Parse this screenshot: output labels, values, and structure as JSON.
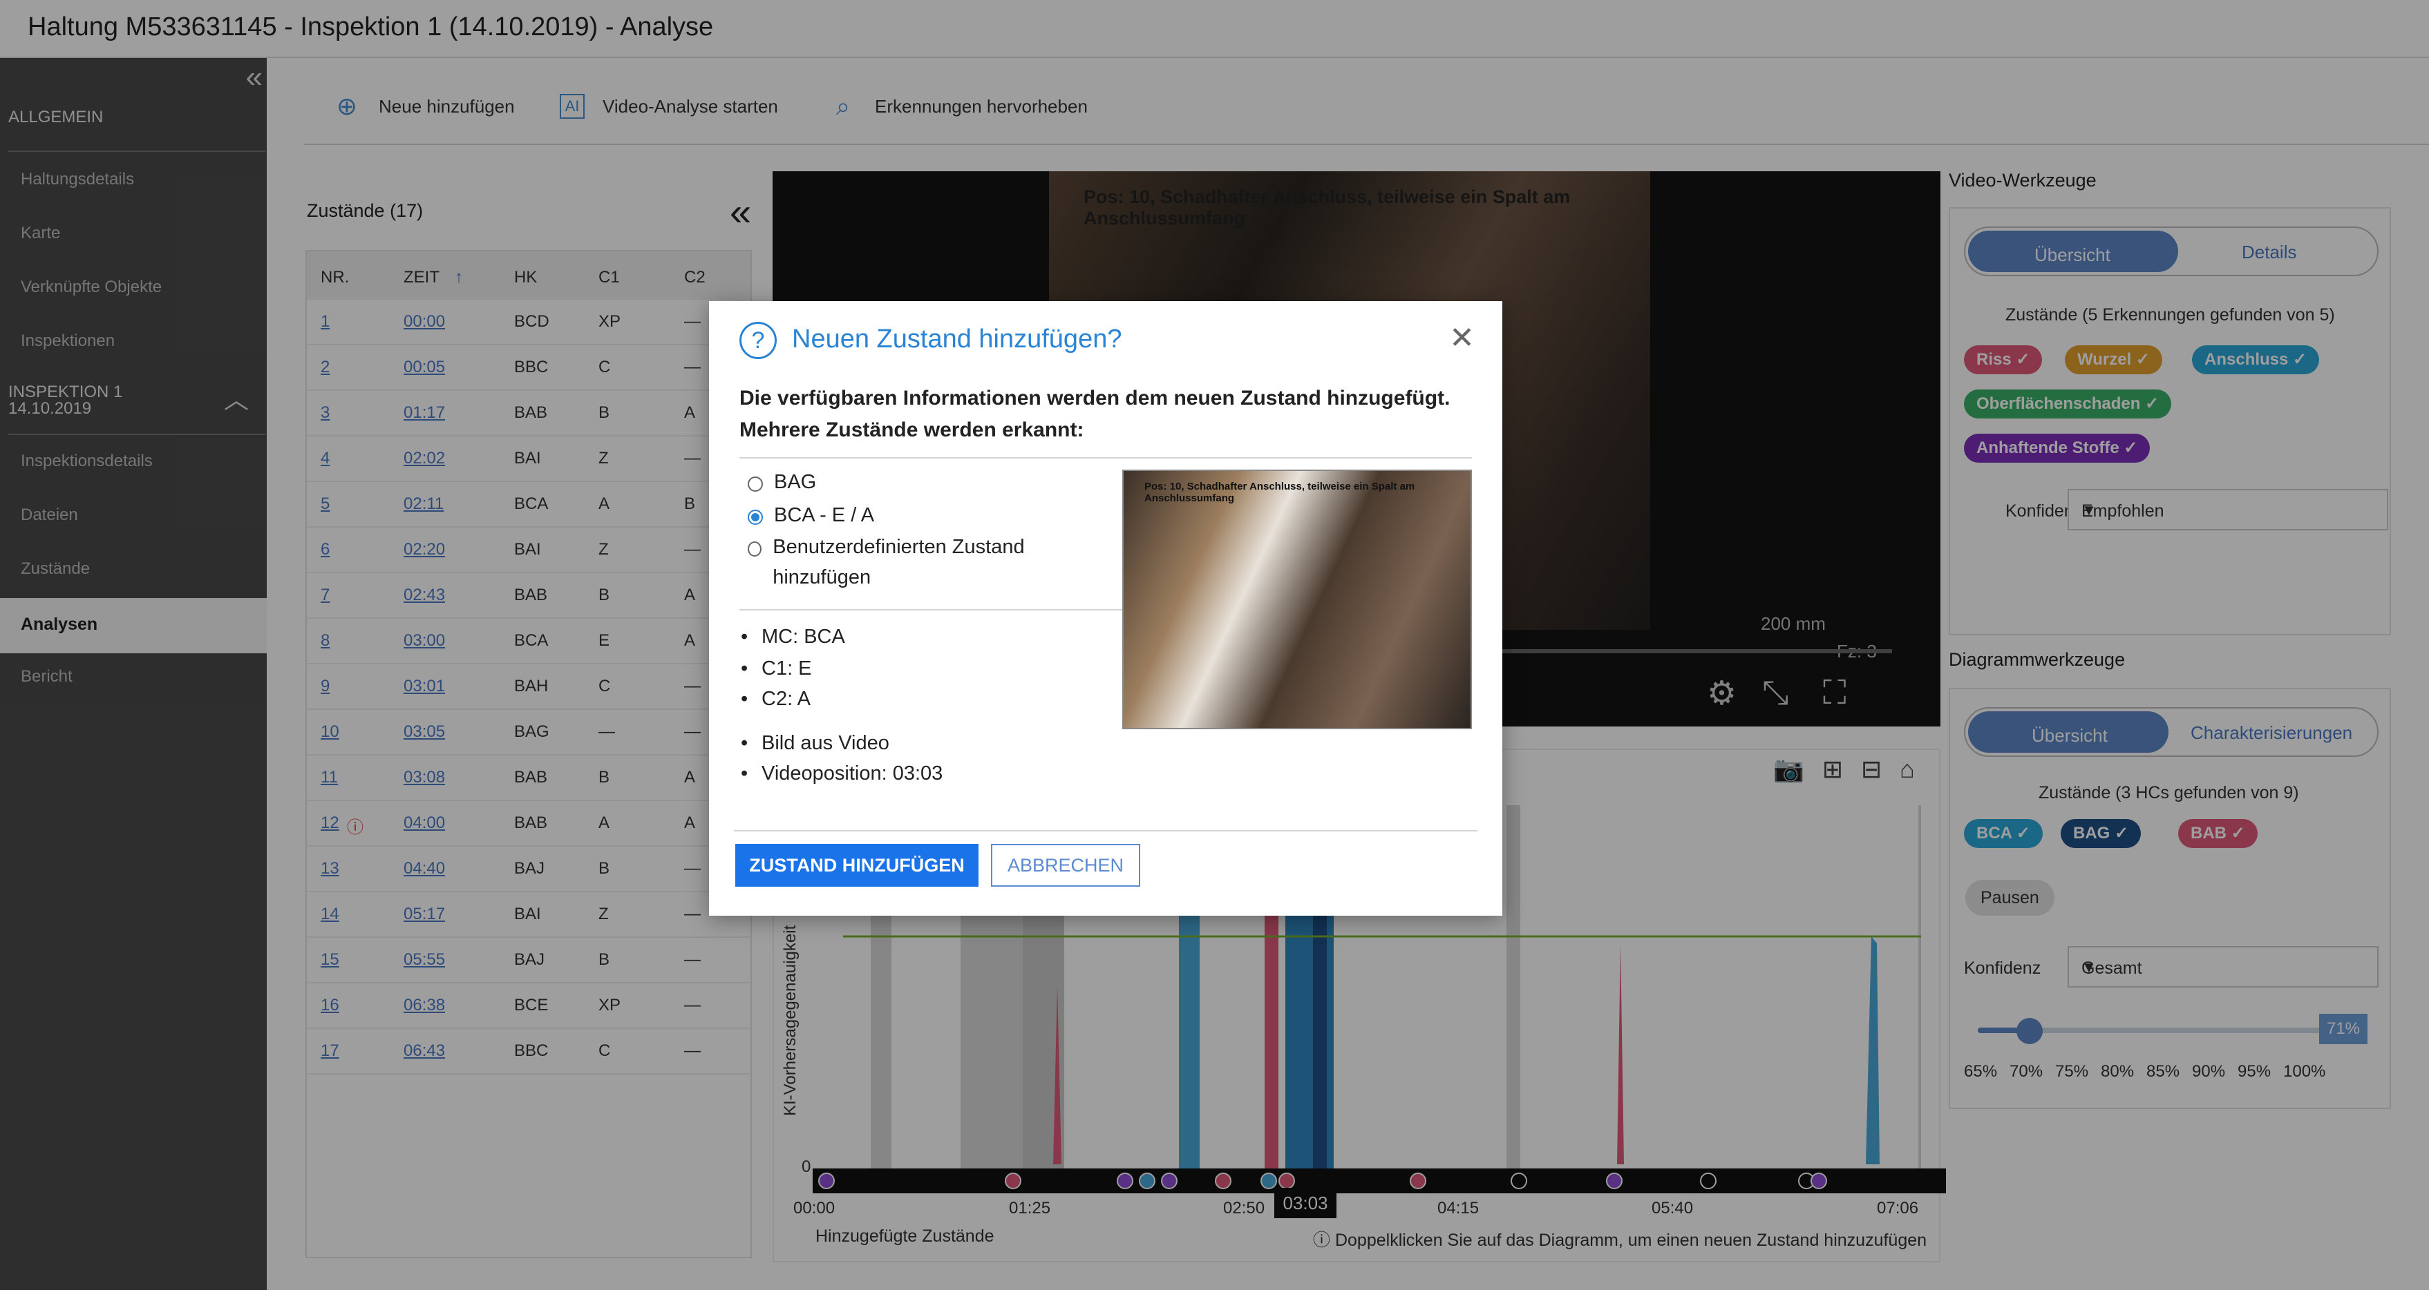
{
  "window": {
    "title": "Haltung M533631145 - Inspektion 1 (14.10.2019) - Analyse"
  },
  "sidebar": {
    "section_general": "ALLGEMEIN",
    "general_items": [
      "Haltungsdetails",
      "Karte",
      "Verknüpfte Objekte",
      "Inspektionen"
    ],
    "section_inspection_line1": "INSPEKTION 1",
    "section_inspection_line2": "14.10.2019",
    "inspection_items": [
      "Inspektionsdetails",
      "Dateien",
      "Zustände",
      "Analysen",
      "Bericht"
    ],
    "active_item": "Analysen"
  },
  "toolbar": {
    "add_new": "Neue hinzufügen",
    "ai_label": "AI",
    "start_video_analysis": "Video-Analyse starten",
    "highlight_detections": "Erkennungen hervorheben"
  },
  "states": {
    "title": "Zustände (17)",
    "columns": [
      "NR.",
      "ZEIT",
      "HK",
      "C1",
      "C2"
    ],
    "rows": [
      {
        "nr": "1",
        "time": "00:00",
        "hk": "BCD",
        "c1": "XP",
        "c2": "—"
      },
      {
        "nr": "2",
        "time": "00:05",
        "hk": "BBC",
        "c1": "C",
        "c2": "—"
      },
      {
        "nr": "3",
        "time": "01:17",
        "hk": "BAB",
        "c1": "B",
        "c2": "A"
      },
      {
        "nr": "4",
        "time": "02:02",
        "hk": "BAI",
        "c1": "Z",
        "c2": "—"
      },
      {
        "nr": "5",
        "time": "02:11",
        "hk": "BCA",
        "c1": "A",
        "c2": "B"
      },
      {
        "nr": "6",
        "time": "02:20",
        "hk": "BAI",
        "c1": "Z",
        "c2": "—"
      },
      {
        "nr": "7",
        "time": "02:43",
        "hk": "BAB",
        "c1": "B",
        "c2": "A"
      },
      {
        "nr": "8",
        "time": "03:00",
        "hk": "BCA",
        "c1": "E",
        "c2": "A"
      },
      {
        "nr": "9",
        "time": "03:01",
        "hk": "BAH",
        "c1": "C",
        "c2": "—"
      },
      {
        "nr": "10",
        "time": "03:05",
        "hk": "BAG",
        "c1": "—",
        "c2": "—"
      },
      {
        "nr": "11",
        "time": "03:08",
        "hk": "BAB",
        "c1": "B",
        "c2": "A"
      },
      {
        "nr": "12",
        "time": "04:00",
        "hk": "BAB",
        "c1": "A",
        "c2": "A"
      },
      {
        "nr": "13",
        "time": "04:40",
        "hk": "BAJ",
        "c1": "B",
        "c2": "—"
      },
      {
        "nr": "14",
        "time": "05:17",
        "hk": "BAI",
        "c1": "Z",
        "c2": "—"
      },
      {
        "nr": "15",
        "time": "05:55",
        "hk": "BAJ",
        "c1": "B",
        "c2": "—"
      },
      {
        "nr": "16",
        "time": "06:38",
        "hk": "BCE",
        "c1": "XP",
        "c2": "—"
      },
      {
        "nr": "17",
        "time": "06:43",
        "hk": "BBC",
        "c1": "C",
        "c2": "—"
      }
    ]
  },
  "video": {
    "caption": "Pos: 10, Schadhafter Anschluss, teilweise ein Spalt am Anschlussumfang",
    "overlay_1": "200 mm",
    "overlay_2": "Fz: 3"
  },
  "chart": {
    "y_label": "KI-Vorhersagegenauigkeit",
    "y_zero": "0",
    "x_ticks": [
      "00:00",
      "01:25",
      "02:50",
      "04:15",
      "05:40",
      "07:06"
    ],
    "cursor_time": "03:03",
    "legend": "Hinzugefügte Zustände",
    "hint": "Doppelklicken Sie auf das Diagramm, um einen neuen Zustand hinzuzufügen"
  },
  "video_tools": {
    "title": "Video-Werkzeuge",
    "tab_overview": "Übersicht",
    "tab_details": "Details",
    "states_line": "Zustände (5 Erkennungen gefunden von 5)",
    "tags": [
      {
        "label": "Riss ✓",
        "color": "#e05a7a"
      },
      {
        "label": "Wurzel ✓",
        "color": "#e0a030"
      },
      {
        "label": "Anschluss ✓",
        "color": "#2aa8d8"
      },
      {
        "label": "Oberflächenschaden ✓",
        "color": "#3ab06a"
      },
      {
        "label": "Anhaftende Stoffe ✓",
        "color": "#7b2fb8"
      }
    ],
    "confidence_label": "Konfidenz",
    "confidence_value": "Empfohlen"
  },
  "diagram_tools": {
    "title": "Diagrammwerkzeuge",
    "tab_overview": "Übersicht",
    "tab_characterizations": "Charakterisierungen",
    "states_line": "Zustände (3 HCs gefunden von 9)",
    "tags": [
      {
        "label": "BCA ✓",
        "color": "#2aa8d8"
      },
      {
        "label": "BAG ✓",
        "color": "#1e4f87"
      },
      {
        "label": "BAB ✓",
        "color": "#e05a7a"
      }
    ],
    "pauses": "Pausen",
    "confidence_label": "Konfidenz",
    "confidence_value": "Gesamt",
    "slider_value": "71%",
    "slider_ticks": [
      "65%",
      "70%",
      "75%",
      "80%",
      "85%",
      "90%",
      "95%",
      "100%"
    ]
  },
  "modal": {
    "title": "Neuen Zustand hinzufügen?",
    "intro": "Die verfügbaren Informationen werden dem neuen Zustand hinzugefügt. Mehrere Zustände werden erkannt:",
    "options": [
      "BAG",
      "BCA - E / A",
      "Benutzerdefinierten Zustand hinzufügen"
    ],
    "selected_option": "BCA - E / A",
    "details": [
      "MC: BCA",
      "C1: E",
      "C2: A"
    ],
    "media": [
      "Bild aus Video",
      "Videoposition: 03:03"
    ],
    "thumb_caption": "Pos: 10, Schadhafter Anschluss, teilweise ein Spalt am Anschlussumfang",
    "confirm": "ZUSTAND HINZUFÜGEN",
    "cancel": "ABBRECHEN"
  }
}
